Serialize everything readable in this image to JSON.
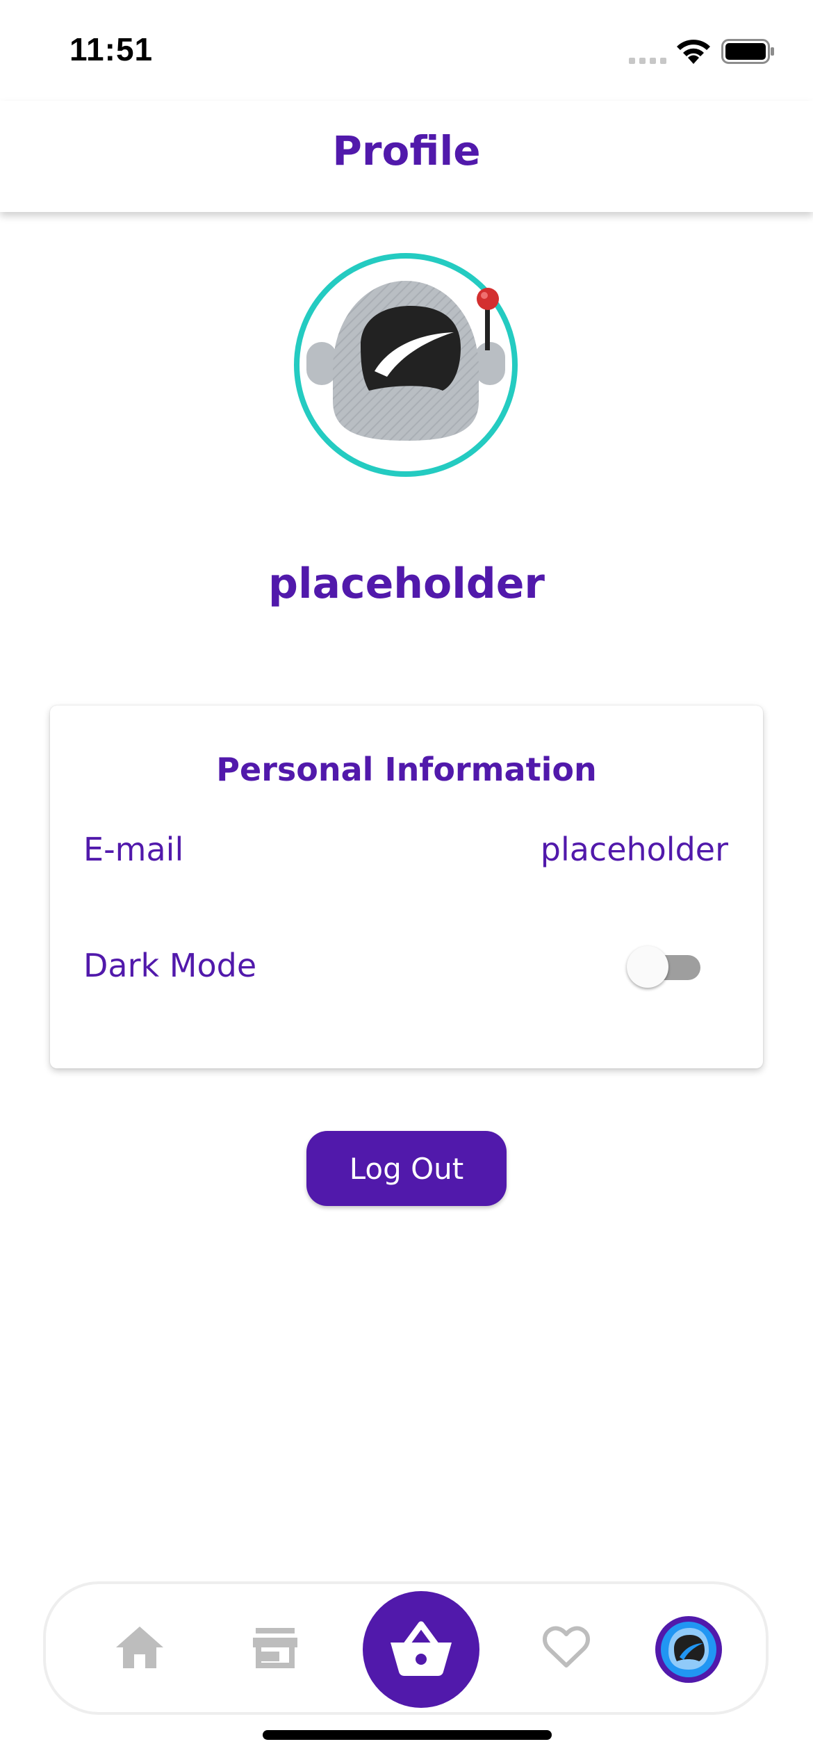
{
  "status_bar": {
    "time": "11:51"
  },
  "header": {
    "title": "Profile"
  },
  "profile": {
    "username": "placeholder",
    "avatar_icon": "astronaut-helmet-icon"
  },
  "personal_info": {
    "title": "Personal Information",
    "email_label": "E-mail",
    "email_value": "placeholder",
    "dark_mode_label": "Dark Mode",
    "dark_mode_enabled": false
  },
  "actions": {
    "logout_label": "Log Out"
  },
  "bottom_nav": {
    "items": [
      {
        "icon": "home-icon"
      },
      {
        "icon": "store-icon"
      },
      {
        "icon": "basket-icon"
      },
      {
        "icon": "heart-icon"
      },
      {
        "icon": "profile-avatar-icon"
      }
    ]
  },
  "colors": {
    "primary": "#5119ab",
    "avatar_ring": "#24cbc1",
    "nav_inactive": "#bdbdbd",
    "toggle_track_off": "#9e9e9e"
  }
}
